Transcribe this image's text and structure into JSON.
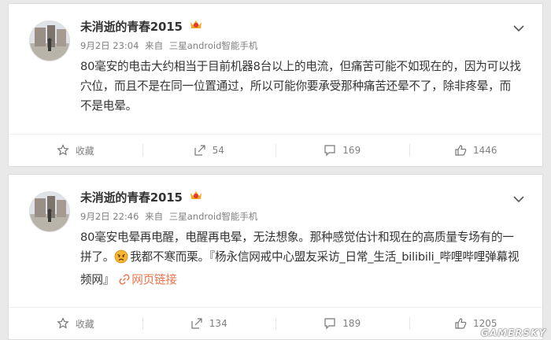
{
  "posts": [
    {
      "username": "未消逝的青春2015",
      "time": "9月2日 23:04",
      "source_prefix": "来自",
      "source": "三星android智能手机",
      "content": "80毫安的电击大约相当于目前机器8台以上的电流，但痛苦可能不如现在的，因为可以找穴位，而且不是在同一位置通过，所以可能你要承受那种痛苦还晕不了，除非疼晕，而不是电晕。",
      "actions": {
        "favorite": "收藏",
        "repost": "54",
        "comment": "169",
        "like": "1446"
      }
    },
    {
      "username": "未消逝的青春2015",
      "time": "9月2日 22:46",
      "source_prefix": "来自",
      "source": "三星android智能手机",
      "content_part1": "80毫安电晕再电醒，电醒再电晕，无法想象。那种感觉估计和现在的高质量专场有的一拼了。",
      "content_part2": "我都不寒而栗。『杨永信网戒中心盟友采访_日常_生活_bilibili_哔哩哔哩弹幕视频网』",
      "link_text": "网页链接",
      "actions": {
        "favorite": "收藏",
        "repost": "134",
        "comment": "189",
        "like": "1205"
      }
    }
  ],
  "watermark": "GAMERSKY",
  "colors": {
    "link": "#eb7350",
    "muted": "#808080",
    "text": "#333333"
  }
}
